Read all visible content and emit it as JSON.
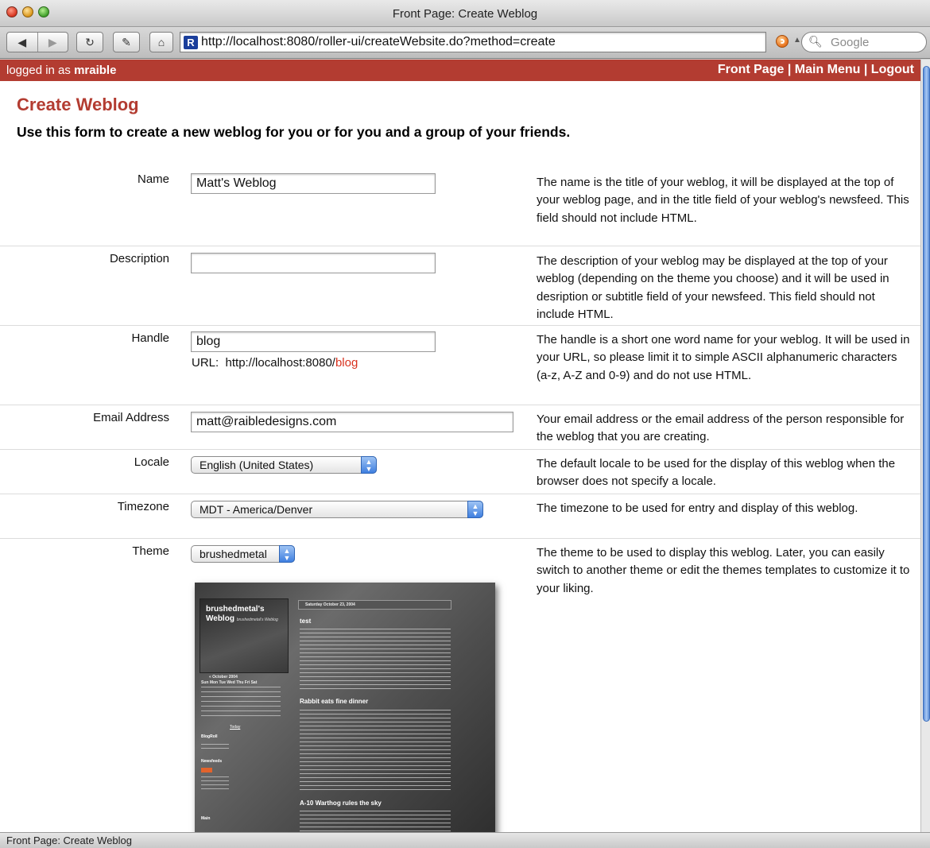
{
  "window": {
    "title": "Front Page: Create Weblog"
  },
  "browser": {
    "url": "http://localhost:8080/roller-ui/createWebsite.do?method=create",
    "search_placeholder": "Google",
    "status_text": "Front Page: Create Weblog"
  },
  "banner": {
    "logged_in_prefix": "logged in as ",
    "username": "mraible",
    "links": [
      "Front Page",
      "Main Menu",
      "Logout"
    ],
    "separator": " | "
  },
  "page": {
    "title": "Create Weblog",
    "subtitle": "Use this form to create a new weblog for you or for you and a group of your friends."
  },
  "form": {
    "name": {
      "label": "Name",
      "value": "Matt's Weblog",
      "help": "The name is the title of your weblog, it will be displayed at the top of your weblog page, and in the title field of your weblog's newsfeed. This field should not include HTML."
    },
    "description": {
      "label": "Description",
      "value": "",
      "help": "The description of your weblog may be displayed at the top of your weblog (depending on the theme you choose) and it will be used in desription or subtitle field of your newsfeed. This field should not include HTML."
    },
    "handle": {
      "label": "Handle",
      "value": "blog",
      "url_label": "URL:",
      "url_base": "http://localhost:8080/",
      "url_handle": "blog",
      "help": "The handle is a short one word name for your weblog. It will be used in your URL, so please limit it to simple ASCII alphanumeric characters (a-z, A-Z and 0-9) and do not use HTML."
    },
    "email": {
      "label": "Email Address",
      "value": "matt@raibledesigns.com",
      "help": "Your email address or the email address of the person responsible for the weblog that you are creating."
    },
    "locale": {
      "label": "Locale",
      "value": "English (United States)",
      "help": "The default locale to be used for the display of this weblog when the browser does not specify a locale."
    },
    "timezone": {
      "label": "Timezone",
      "value": "MDT - America/Denver",
      "help": "The timezone to be used for entry and display of this weblog."
    },
    "theme": {
      "label": "Theme",
      "value": "brushedmetal",
      "help": "The theme to be used to display this weblog. Later, you can easily switch to another theme or edit the themes templates to customize it to your liking."
    }
  },
  "theme_preview": {
    "blog_title_line1": "brushedmetal's",
    "blog_title_line2": "Weblog",
    "blog_tagline": "brushedmetal's Weblog",
    "date_header": "Saturday October 23, 2004",
    "post_titles": [
      "test",
      "Rabbit eats fine dinner",
      "A-10 Warthog rules the sky"
    ],
    "calendar_month": "« October 2004",
    "calendar_days": "Sun Mon Tue Wed Thu Fri Sat",
    "today_link": "Today",
    "sidebar_headings": [
      "BlogRoll",
      "Newsfeeds",
      "Main"
    ]
  },
  "colors": {
    "accent": "#b33c31",
    "handle_url": "#d8321f"
  }
}
